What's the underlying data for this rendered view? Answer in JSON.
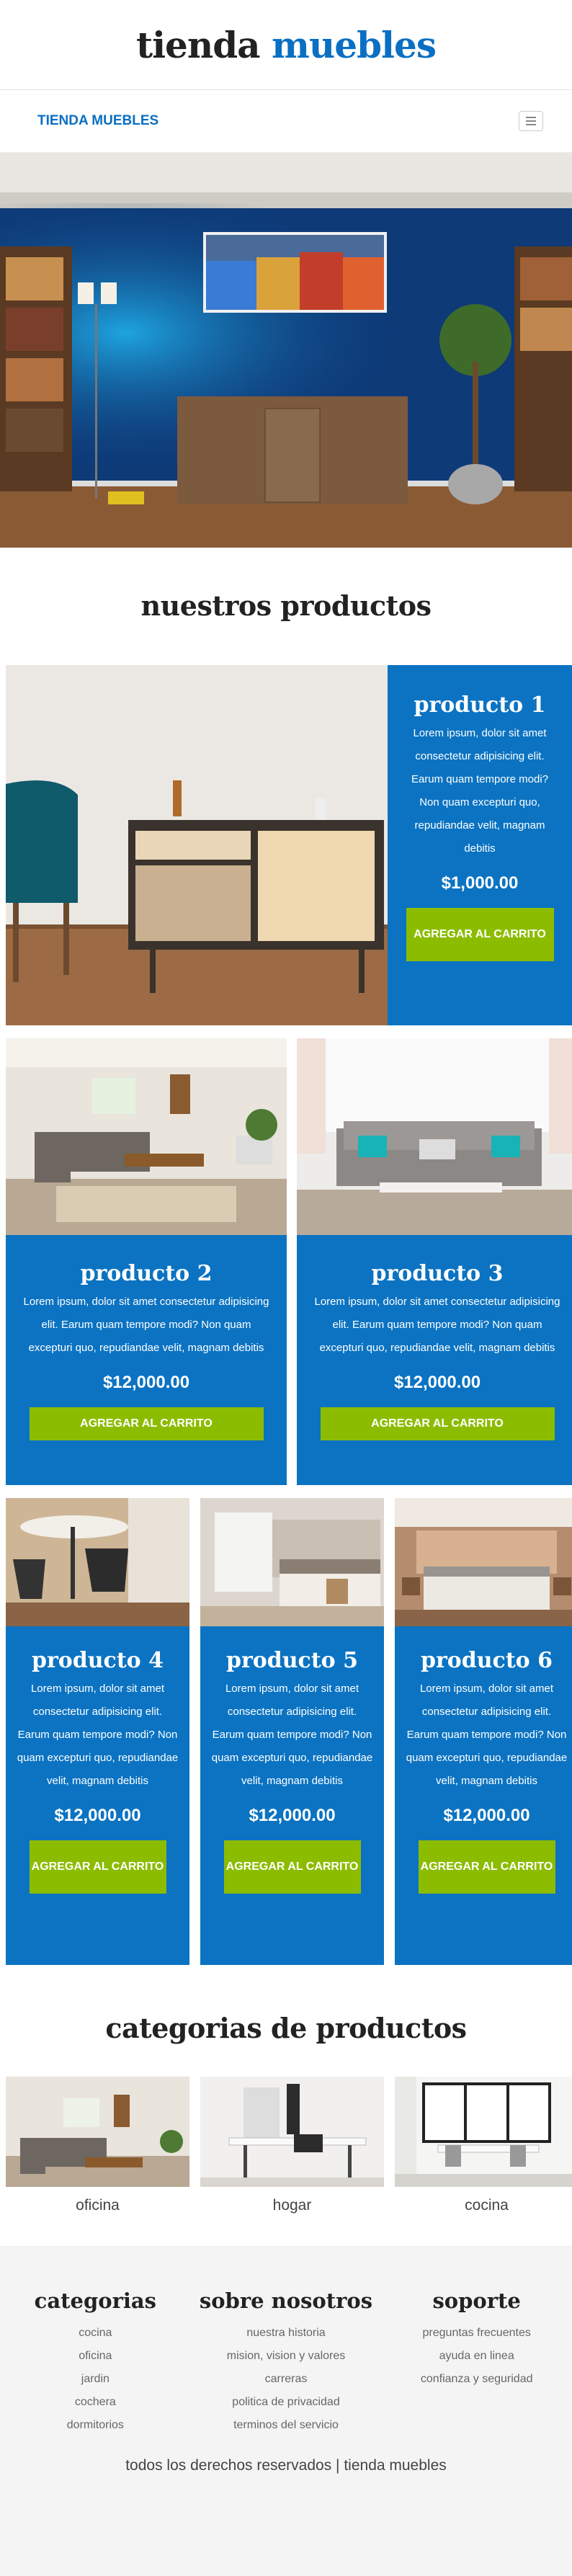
{
  "header": {
    "logo_part1": "tienda",
    "logo_part2": "muebles"
  },
  "nav": {
    "brand": "TIENDA MUEBLES"
  },
  "products_title": "nuestros productos",
  "products": [
    {
      "name": "producto 1",
      "desc": "Lorem ipsum, dolor sit amet consectetur adipisicing elit. Earum quam tempore modi? Non quam excepturi quo, repudiandae velit, magnam debitis",
      "price": "$1,000.00",
      "button": "AGREGAR AL CARRITO"
    },
    {
      "name": "producto 2",
      "desc": "Lorem ipsum, dolor sit amet consectetur adipisicing elit. Earum quam tempore modi? Non quam excepturi quo, repudiandae velit, magnam debitis",
      "price": "$12,000.00",
      "button": "AGREGAR AL CARRITO"
    },
    {
      "name": "producto 3",
      "desc": "Lorem ipsum, dolor sit amet consectetur adipisicing elit. Earum quam tempore modi? Non quam excepturi quo, repudiandae velit, magnam debitis",
      "price": "$12,000.00",
      "button": "AGREGAR AL CARRITO"
    },
    {
      "name": "producto 4",
      "desc": "Lorem ipsum, dolor sit amet consectetur adipisicing elit. Earum quam tempore modi? Non quam excepturi quo, repudiandae velit, magnam debitis",
      "price": "$12,000.00",
      "button": "AGREGAR AL CARRITO"
    },
    {
      "name": "producto 5",
      "desc": "Lorem ipsum, dolor sit amet consectetur adipisicing elit. Earum quam tempore modi? Non quam excepturi quo, repudiandae velit, magnam debitis",
      "price": "$12,000.00",
      "button": "AGREGAR AL CARRITO"
    },
    {
      "name": "producto 6",
      "desc": "Lorem ipsum, dolor sit amet consectetur adipisicing elit. Earum quam tempore modi? Non quam excepturi quo, repudiandae velit, magnam debitis",
      "price": "$12,000.00",
      "button": "AGREGAR AL CARRITO"
    }
  ],
  "categories_title": "categorias de productos",
  "categories": [
    {
      "label": "oficina"
    },
    {
      "label": "hogar"
    },
    {
      "label": "cocina"
    }
  ],
  "footer": {
    "columns": [
      {
        "title": "categorias",
        "links": [
          "cocina",
          "oficina",
          "jardin",
          "cochera",
          "dormitorios"
        ]
      },
      {
        "title": "sobre nosotros",
        "links": [
          "nuestra historia",
          "mision, vision y valores",
          "carreras",
          "politica de privacidad",
          "terminos del servicio"
        ]
      },
      {
        "title": "soporte",
        "links": [
          "preguntas frecuentes",
          "ayuda en linea",
          "confianza y seguridad"
        ]
      }
    ],
    "copyright": "todos los derechos reservados | tienda muebles"
  },
  "colors": {
    "primary": "#0b73c2",
    "button": "#8cbc00"
  }
}
